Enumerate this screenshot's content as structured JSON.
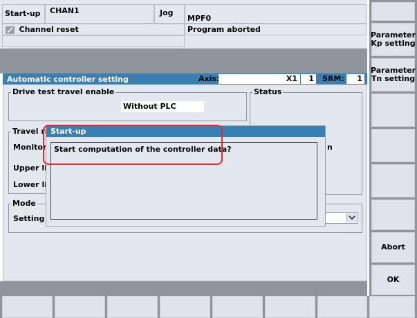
{
  "header": {
    "area": "Start-up",
    "channel": "CHAN1",
    "mode": "Jog",
    "program": "MPF0",
    "channel_status": "Channel reset",
    "program_status": "Program aborted"
  },
  "panel": {
    "title": "Automatic controller setting",
    "axis_label": "Axis:",
    "axis_value": "X1",
    "axis_number": "1",
    "srm_label": "SRM:",
    "srm_value": "1"
  },
  "drive_test": {
    "title": "Drive test travel enable",
    "value": "Without PLC"
  },
  "status": {
    "title": "Status"
  },
  "travel": {
    "title": "Travel ra",
    "monitoring_label": "Monitori",
    "upper_label": "Upper lim",
    "lower_label": "Lower lim",
    "right_fragment": "n"
  },
  "mode_group": {
    "title": "Mode",
    "setting_label": "Setting m",
    "dropdown_icon": "chevron-down-icon"
  },
  "dialog": {
    "title": "Start-up",
    "message": "Start computation of the controller data?"
  },
  "softkeys": {
    "right": [
      {
        "label": ""
      },
      {
        "label": "Parameter\nKp setting"
      },
      {
        "label": "Parameter\nTn setting"
      },
      {
        "label": ""
      },
      {
        "label": ""
      },
      {
        "label": ""
      },
      {
        "label": ""
      },
      {
        "label": "Abort"
      },
      {
        "label": "OK"
      }
    ],
    "bottom_count": 8
  },
  "colors": {
    "titlebar": "#3a7fb2",
    "panel_bg": "#e3e8ee",
    "highlight": "#e8262b",
    "softkey_bg": "#dfe4ea"
  }
}
